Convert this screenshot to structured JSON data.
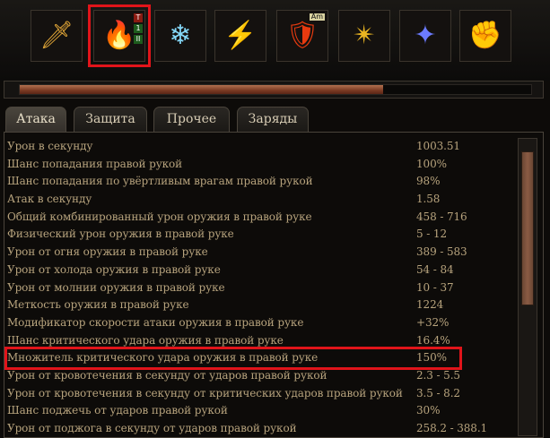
{
  "skill_slots": [
    {
      "icon": "sword-icon",
      "glyph": "🗡"
    },
    {
      "icon": "fire-demon-icon",
      "glyph": "🔥",
      "badges": [
        "T",
        "1",
        "II"
      ],
      "selected": true
    },
    {
      "icon": "frost-warrior-icon",
      "glyph": "❄"
    },
    {
      "icon": "green-slash-icon",
      "glyph": "⚡"
    },
    {
      "icon": "shield-warrior-icon",
      "glyph": "🛡",
      "badge": "Am"
    },
    {
      "icon": "golden-rune-icon",
      "glyph": "✴"
    },
    {
      "icon": "blue-spark-icon",
      "glyph": "✦"
    },
    {
      "icon": "fist-icon",
      "glyph": "✊"
    }
  ],
  "experience_bar": {
    "fill": 0.71
  },
  "tabs": [
    {
      "label": "Атака",
      "active": true
    },
    {
      "label": "Защита",
      "active": false
    },
    {
      "label": "Прочее",
      "active": false
    },
    {
      "label": "Заряды",
      "active": false
    }
  ],
  "stats": [
    {
      "label": "Урон в секунду",
      "value": "1003.51"
    },
    {
      "label": "Шанс попадания правой рукой",
      "value": "100%"
    },
    {
      "label": "Шанс попадания по увёртливым врагам правой рукой",
      "value": "98%"
    },
    {
      "label": "Атак в секунду",
      "value": "1.58"
    },
    {
      "label": "Общий комбинированный урон оружия в правой руке",
      "value": "458 - 716"
    },
    {
      "label": "Физический урон оружия в правой руке",
      "value": "5 - 12"
    },
    {
      "label": "Урон от огня оружия в правой руке",
      "value": "389 - 583"
    },
    {
      "label": "Урон от холода оружия в правой руке",
      "value": "54 - 84"
    },
    {
      "label": "Урон от молнии оружия в правой руке",
      "value": "10 - 37"
    },
    {
      "label": "Меткость оружия в правой руке",
      "value": "1224"
    },
    {
      "label": "Модификатор скорости атаки оружия в правой руке",
      "value": "+32%"
    },
    {
      "label": "Шанс критического удара оружия в правой руке",
      "value": "16.4%"
    },
    {
      "label": "Множитель критического удара оружия в правой руке",
      "value": "150%",
      "highlighted": true
    },
    {
      "label": "Урон от кровотечения в секунду от ударов правой рукой",
      "value": "2.3 - 5.5"
    },
    {
      "label": "Урон от кровотечения в секунду от критических ударов правой рукой",
      "value": "3.5 - 8.2"
    },
    {
      "label": "Шанс поджечь от ударов правой рукой",
      "value": "30%"
    },
    {
      "label": "Урон от поджога в секунду от ударов правой рукой",
      "value": "258.2 - 388.1"
    }
  ],
  "scrollbar": {
    "position": 0.0
  },
  "colors": {
    "highlight": "#e0141a",
    "stat_text": "#b7a37d",
    "tab_text": "#d8cdb5"
  }
}
